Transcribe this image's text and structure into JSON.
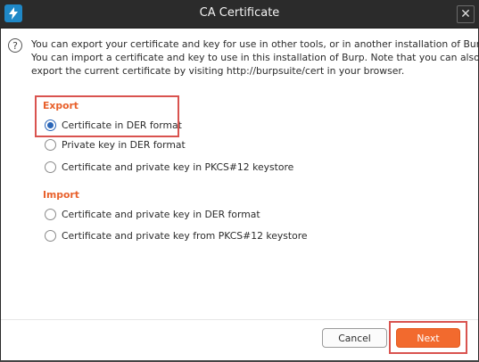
{
  "window": {
    "title": "CA Certificate",
    "app_icon": "burp-lightning-icon",
    "close_symbol": "✕"
  },
  "intro": {
    "lines": [
      "You can export your certificate and key for use in other tools, or in another installation of Burp.",
      "You can import a certificate and key to use in this installation of Burp. Note that you can also",
      "export the current certificate by visiting http://burpsuite/cert in your browser."
    ]
  },
  "export": {
    "title": "Export",
    "options": [
      {
        "label": "Certificate in DER format",
        "selected": true
      },
      {
        "label": "Private key in DER format",
        "selected": false
      },
      {
        "label": "Certificate and private key in PKCS#12 keystore",
        "selected": false
      }
    ]
  },
  "import": {
    "title": "Import",
    "options": [
      {
        "label": "Certificate and private key in DER format",
        "selected": false
      },
      {
        "label": "Certificate and private key from PKCS#12 keystore",
        "selected": false
      }
    ]
  },
  "buttons": {
    "cancel": "Cancel",
    "next": "Next"
  },
  "colors": {
    "accent": "#f26a2e",
    "section_title": "#e8612c",
    "radio_selected": "#2a66b8",
    "highlight_box": "#d9534f"
  }
}
